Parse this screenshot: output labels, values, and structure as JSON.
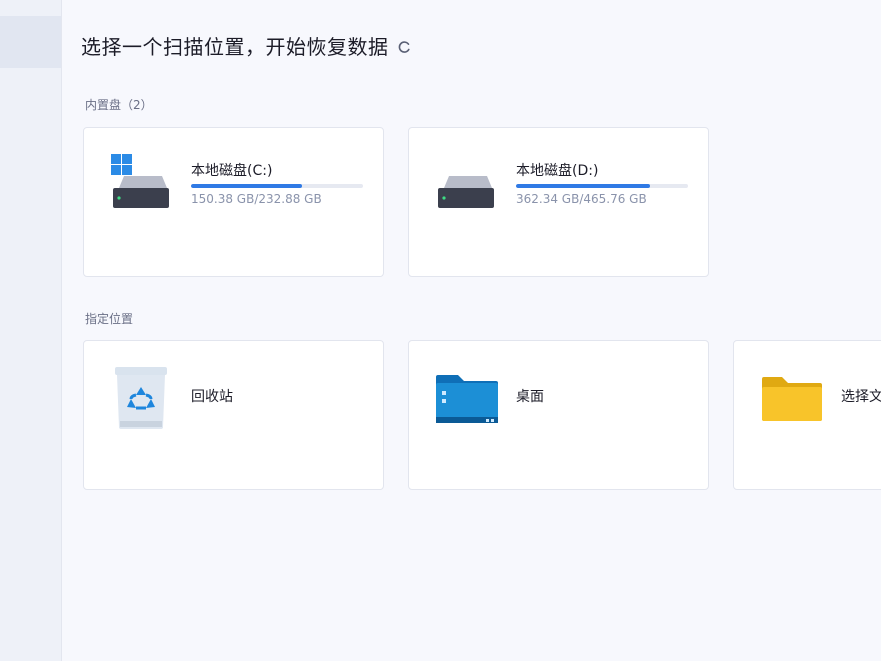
{
  "header": {
    "title": "选择一个扫描位置，开始恢复数据"
  },
  "sections": {
    "internal_label": "内置盘（2）",
    "locations_label": "指定位置"
  },
  "drives": [
    {
      "name": "本地磁盘(C:)",
      "usage": "150.38 GB/232.88 GB",
      "used_fraction": 0.646,
      "system": true
    },
    {
      "name": "本地磁盘(D:)",
      "usage": "362.34 GB/465.76 GB",
      "used_fraction": 0.778,
      "system": false
    }
  ],
  "locations": [
    {
      "name": "回收站",
      "icon": "recycle-bin-icon"
    },
    {
      "name": "桌面",
      "icon": "desktop-folder-icon"
    },
    {
      "name": "选择文",
      "icon": "folder-icon"
    }
  ],
  "colors": {
    "accent": "#2f7ae5",
    "background": "#f7f8fd",
    "folder_yellow": "#f8c42a",
    "desktop_blue": "#1c8fd6"
  }
}
